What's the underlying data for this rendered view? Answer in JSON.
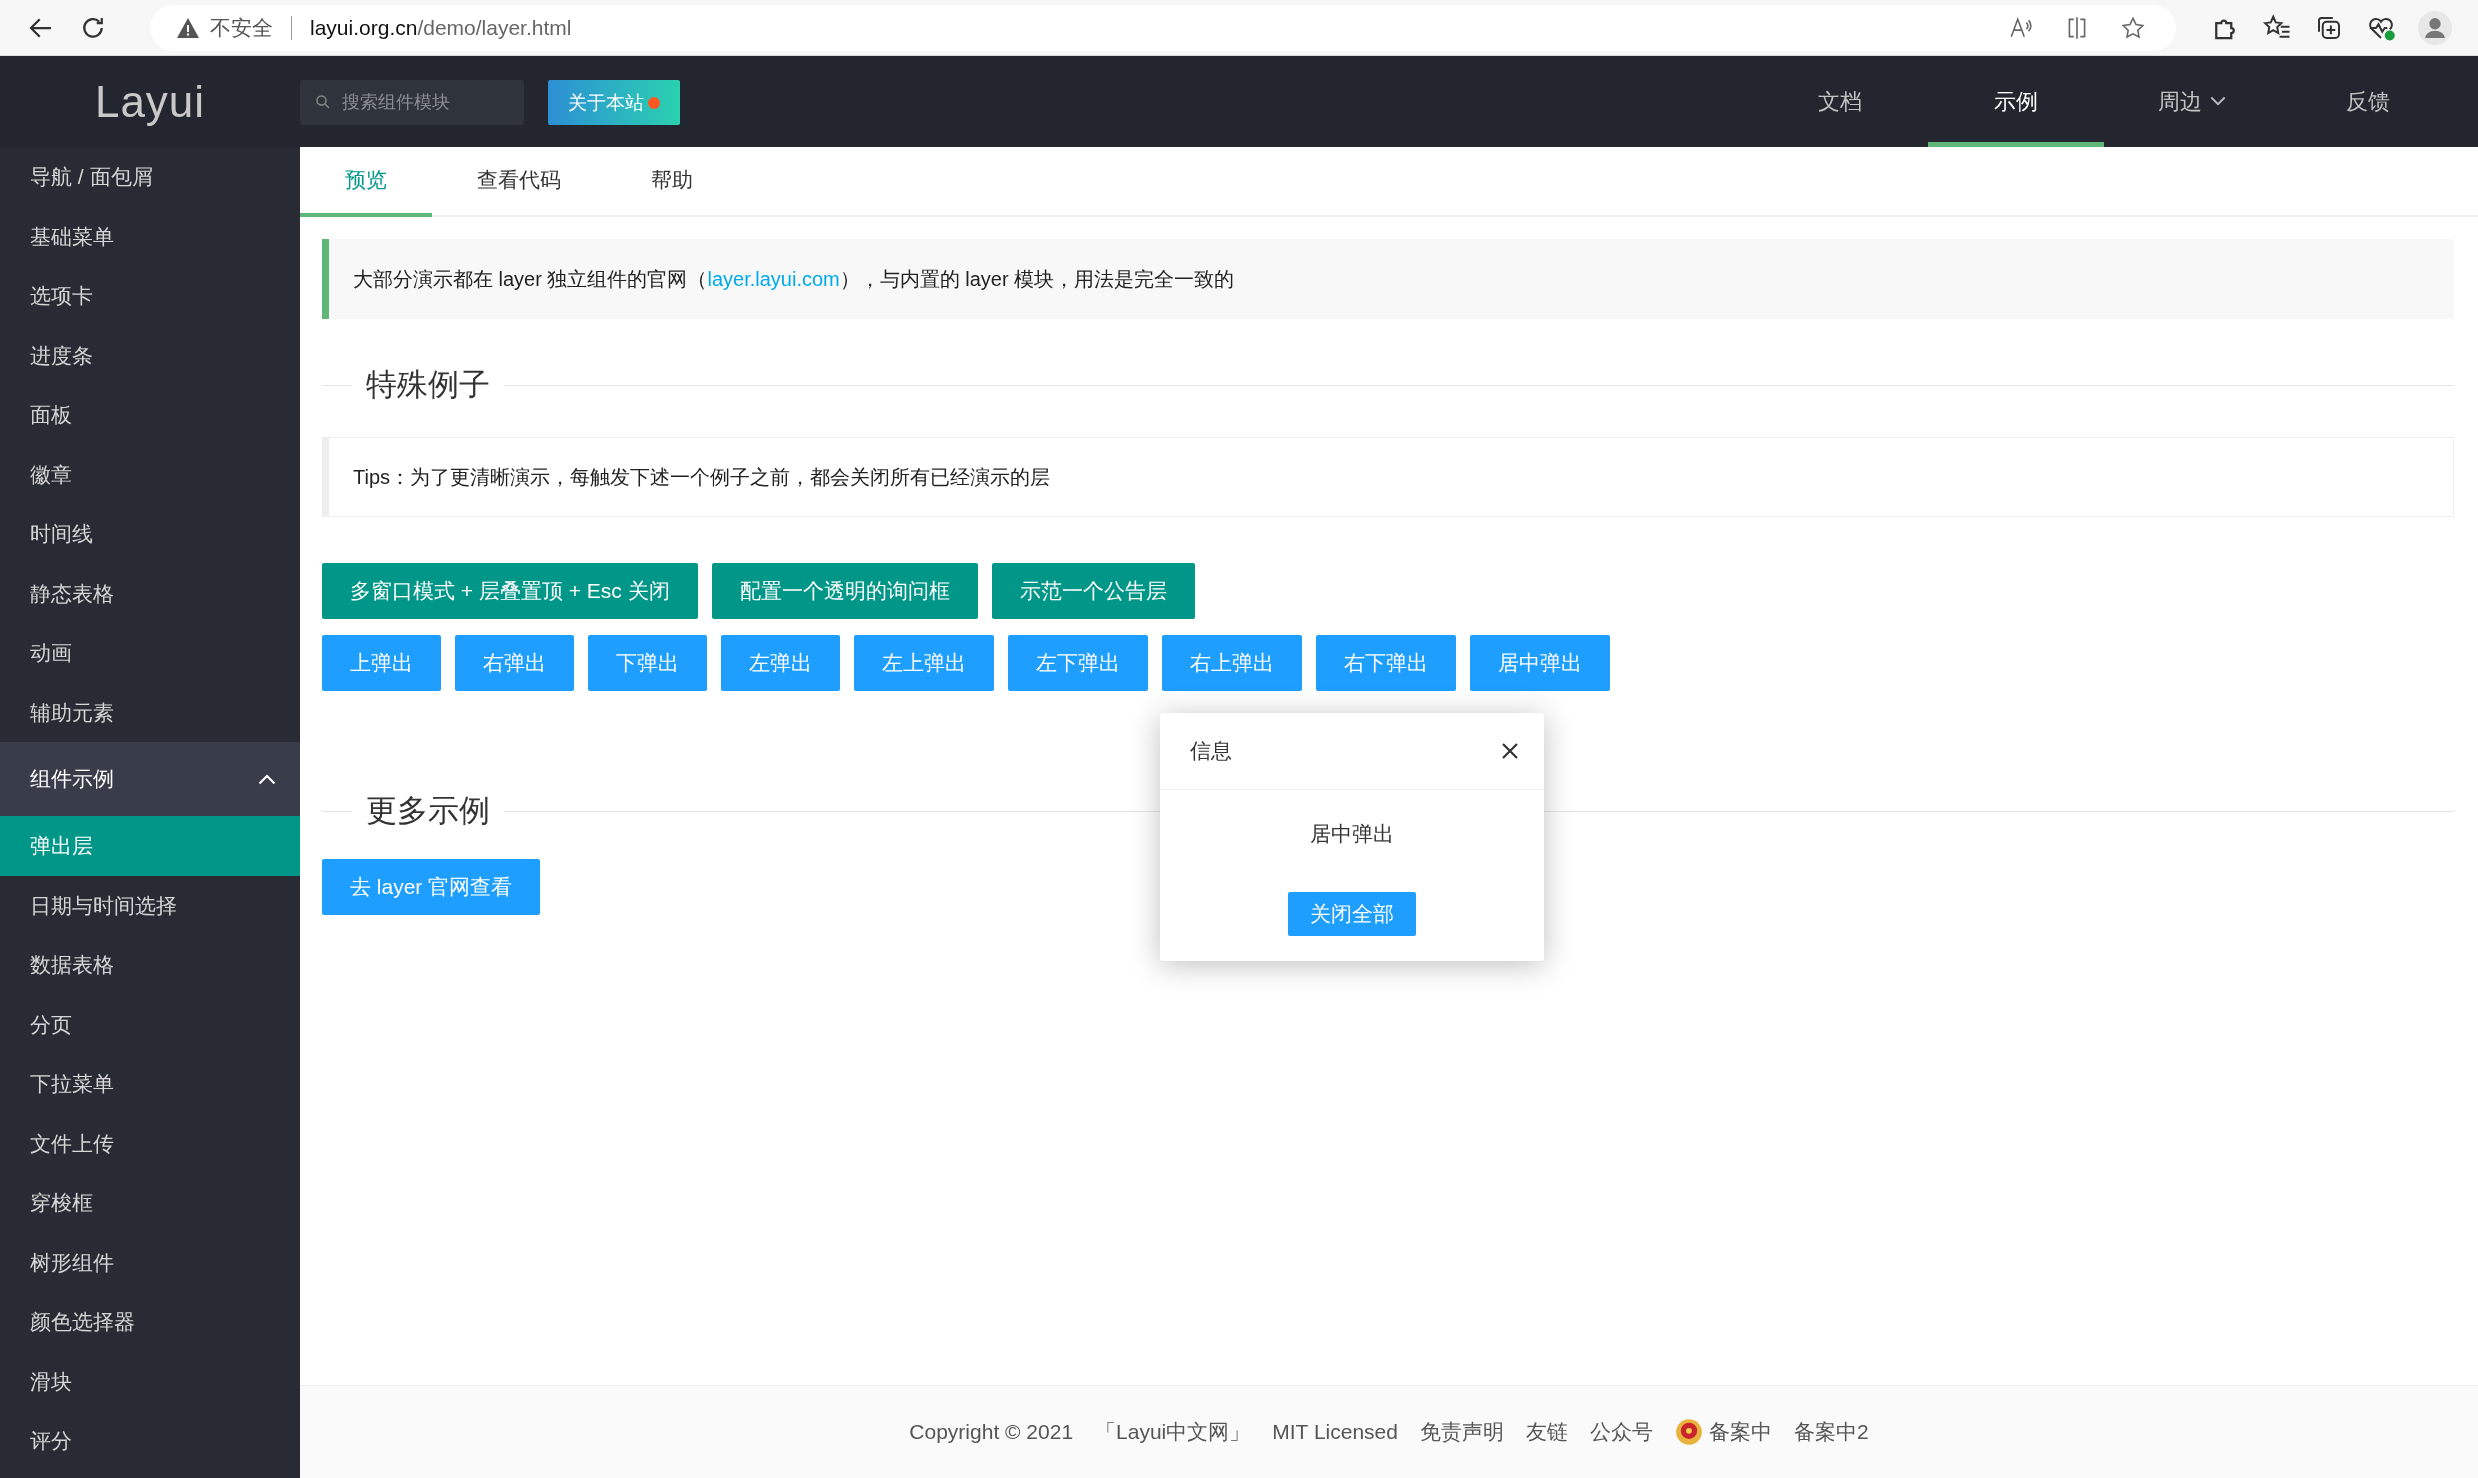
{
  "browser": {
    "security": "不安全",
    "url_host": "layui.org.cn",
    "url_path": "/demo/layer.html"
  },
  "header": {
    "logo": "Layui",
    "search": {
      "placeholder": "搜索组件模块"
    },
    "about_button": "关于本站",
    "nav": [
      {
        "label": "文档",
        "selected": false,
        "kind": "link"
      },
      {
        "label": "示例",
        "selected": true,
        "kind": "link"
      },
      {
        "label": "周边",
        "selected": false,
        "kind": "dropdown"
      },
      {
        "label": "反馈",
        "selected": false,
        "kind": "link"
      }
    ]
  },
  "sidebar": {
    "items": [
      {
        "label": "导航 / 面包屑",
        "selected": false
      },
      {
        "label": "基础菜单",
        "selected": false
      },
      {
        "label": "选项卡",
        "selected": false
      },
      {
        "label": "进度条",
        "selected": false
      },
      {
        "label": "面板",
        "selected": false
      },
      {
        "label": "徽章",
        "selected": false
      },
      {
        "label": "时间线",
        "selected": false
      },
      {
        "label": "静态表格",
        "selected": false
      },
      {
        "label": "动画",
        "selected": false
      },
      {
        "label": "辅助元素",
        "selected": false
      }
    ],
    "group": {
      "label": "组件示例",
      "expanded": true,
      "items": [
        {
          "label": "弹出层",
          "selected": true
        },
        {
          "label": "日期与时间选择",
          "selected": false
        },
        {
          "label": "数据表格",
          "selected": false
        },
        {
          "label": "分页",
          "selected": false
        },
        {
          "label": "下拉菜单",
          "selected": false
        },
        {
          "label": "文件上传",
          "selected": false
        },
        {
          "label": "穿梭框",
          "selected": false
        },
        {
          "label": "树形组件",
          "selected": false
        },
        {
          "label": "颜色选择器",
          "selected": false
        },
        {
          "label": "滑块",
          "selected": false
        },
        {
          "label": "评分",
          "selected": false
        }
      ]
    }
  },
  "tabs": [
    {
      "label": "预览",
      "selected": true
    },
    {
      "label": "查看代码",
      "selected": false
    },
    {
      "label": "帮助",
      "selected": false
    }
  ],
  "notice": {
    "before": "大部分演示都在 layer 独立组件的官网（",
    "link": "layer.layui.com",
    "after": "），与内置的 layer 模块，用法是完全一致的"
  },
  "special": {
    "legend": "特殊例子",
    "tip": "Tips：为了更清晰演示，每触发下述一个例子之前，都会关闭所有已经演示的层",
    "button_rows": [
      [
        {
          "label": "多窗口模式 + 层叠置顶 + Esc 关闭",
          "kind": "default"
        },
        {
          "label": "配置一个透明的询问框",
          "kind": "default"
        },
        {
          "label": "示范一个公告层",
          "kind": "default"
        }
      ],
      [
        {
          "label": "上弹出",
          "kind": "normal"
        },
        {
          "label": "右弹出",
          "kind": "normal"
        },
        {
          "label": "下弹出",
          "kind": "normal"
        },
        {
          "label": "左弹出",
          "kind": "normal"
        },
        {
          "label": "左上弹出",
          "kind": "normal"
        },
        {
          "label": "左下弹出",
          "kind": "normal"
        },
        {
          "label": "右上弹出",
          "kind": "normal"
        },
        {
          "label": "右下弹出",
          "kind": "normal"
        },
        {
          "label": "居中弹出",
          "kind": "normal"
        }
      ]
    ]
  },
  "more": {
    "legend": "更多示例",
    "buttons": [
      {
        "label": "去 layer 官网查看",
        "kind": "normal"
      }
    ]
  },
  "popup": {
    "title": "信息",
    "message": "居中弹出",
    "button": "关闭全部"
  },
  "footer": [
    {
      "text": "Copyright © 2021",
      "kind": "text"
    },
    {
      "text": "「Layui中文网」",
      "kind": "link"
    },
    {
      "text": "MIT Licensed",
      "kind": "link"
    },
    {
      "text": "免责声明",
      "kind": "link"
    },
    {
      "text": "友链",
      "kind": "link"
    },
    {
      "text": "公众号",
      "kind": "link"
    },
    {
      "text": "备案中",
      "kind": "emblem"
    },
    {
      "text": "备案中2",
      "kind": "link"
    }
  ]
}
